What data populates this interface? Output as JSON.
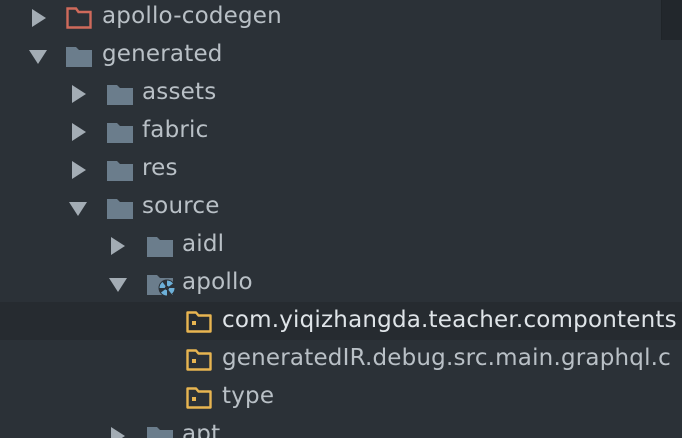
{
  "colors": {
    "background": "#2b3137",
    "selected_row": "#262b30",
    "folder": "#6b7d8c",
    "folder_red": "#cf6a5b",
    "package": "#e8b551",
    "arrow": "#a3acb4",
    "text": "#b9c0c6"
  },
  "tree": {
    "apollo_codegen": {
      "label": "apollo-codegen",
      "icon": "folder-icon",
      "state": "collapsed"
    },
    "generated": {
      "label": "generated",
      "icon": "folder-icon",
      "state": "expanded"
    },
    "assets": {
      "label": "assets",
      "icon": "folder-icon",
      "state": "collapsed"
    },
    "fabric": {
      "label": "fabric",
      "icon": "folder-icon",
      "state": "collapsed"
    },
    "res": {
      "label": "res",
      "icon": "folder-icon",
      "state": "collapsed"
    },
    "source": {
      "label": "source",
      "icon": "folder-icon",
      "state": "expanded"
    },
    "aidl": {
      "label": "aidl",
      "icon": "folder-icon",
      "state": "collapsed"
    },
    "apollo": {
      "label": "apollo",
      "icon": "source-folder-icon",
      "state": "expanded"
    },
    "pkg_compontents": {
      "label": "com.yiqizhangda.teacher.compontents",
      "icon": "package-icon"
    },
    "pkg_generated_ir": {
      "label": "generatedIR.debug.src.main.graphql.c",
      "icon": "package-icon"
    },
    "pkg_type": {
      "label": "type",
      "icon": "package-icon"
    },
    "apt": {
      "label": "apt",
      "icon": "folder-icon",
      "state": "collapsed"
    }
  }
}
